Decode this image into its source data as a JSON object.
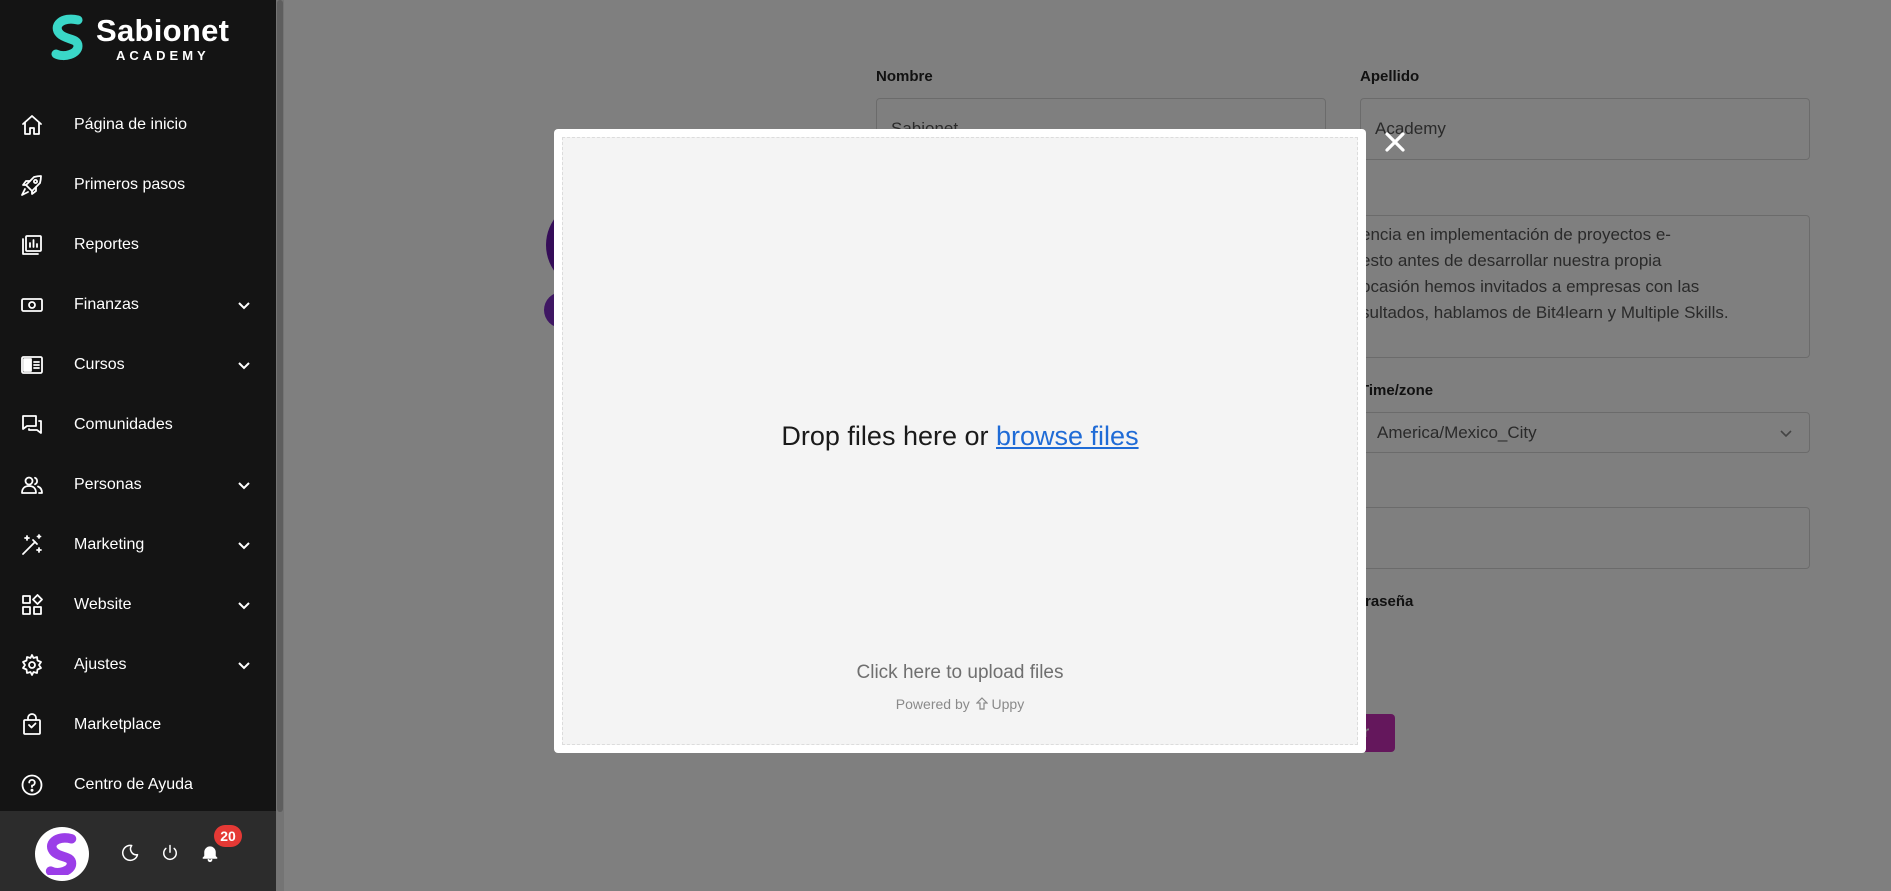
{
  "brand": {
    "name": "Sabionet",
    "subtitle": "ACADEMY",
    "colors": {
      "teal": "#3ad7c8",
      "purple": "#9b3ee8"
    }
  },
  "sidebar": {
    "items": [
      {
        "label": "Página de inicio",
        "icon": "home-icon",
        "expandable": false
      },
      {
        "label": "Primeros pasos",
        "icon": "rocket-icon",
        "expandable": false
      },
      {
        "label": "Reportes",
        "icon": "report-icon",
        "expandable": false
      },
      {
        "label": "Finanzas",
        "icon": "money-icon",
        "expandable": true
      },
      {
        "label": "Cursos",
        "icon": "book-icon",
        "expandable": true
      },
      {
        "label": "Comunidades",
        "icon": "chat-icon",
        "expandable": false
      },
      {
        "label": "Personas",
        "icon": "people-icon",
        "expandable": true
      },
      {
        "label": "Marketing",
        "icon": "magic-wand-icon",
        "expandable": true
      },
      {
        "label": "Website",
        "icon": "widgets-icon",
        "expandable": true
      },
      {
        "label": "Ajustes",
        "icon": "gear-icon",
        "expandable": true
      },
      {
        "label": "Marketplace",
        "icon": "shopping-bag-icon",
        "expandable": false
      },
      {
        "label": "Centro de Ayuda",
        "icon": "help-icon",
        "expandable": false
      }
    ],
    "bottom": {
      "notifications_count": "20",
      "tools": [
        "theme-toggle-icon",
        "power-icon",
        "bell-icon"
      ]
    }
  },
  "form": {
    "nombre_label": "Nombre",
    "nombre_value": "Sabionet",
    "apellido_label": "Apellido",
    "apellido_value": "Academy",
    "bio_lines": [
      "encia en implementación de proyectos e-",
      "esto antes de desarrollar nuestra propia",
      "ocasión hemos invitados a empresas con las",
      "sultados, hablamos de Bit4learn y Multiple Skills."
    ],
    "timezone_label": "Time/zone",
    "timezone_value": "America/Mexico_City",
    "password_label": "traseña",
    "submit_label": "r"
  },
  "uploader": {
    "drop_text": "Drop files here or",
    "browse_link": "browse files",
    "click_text": "Click here to upload files",
    "powered_by": "Powered by",
    "powered_brand": "Uppy"
  }
}
